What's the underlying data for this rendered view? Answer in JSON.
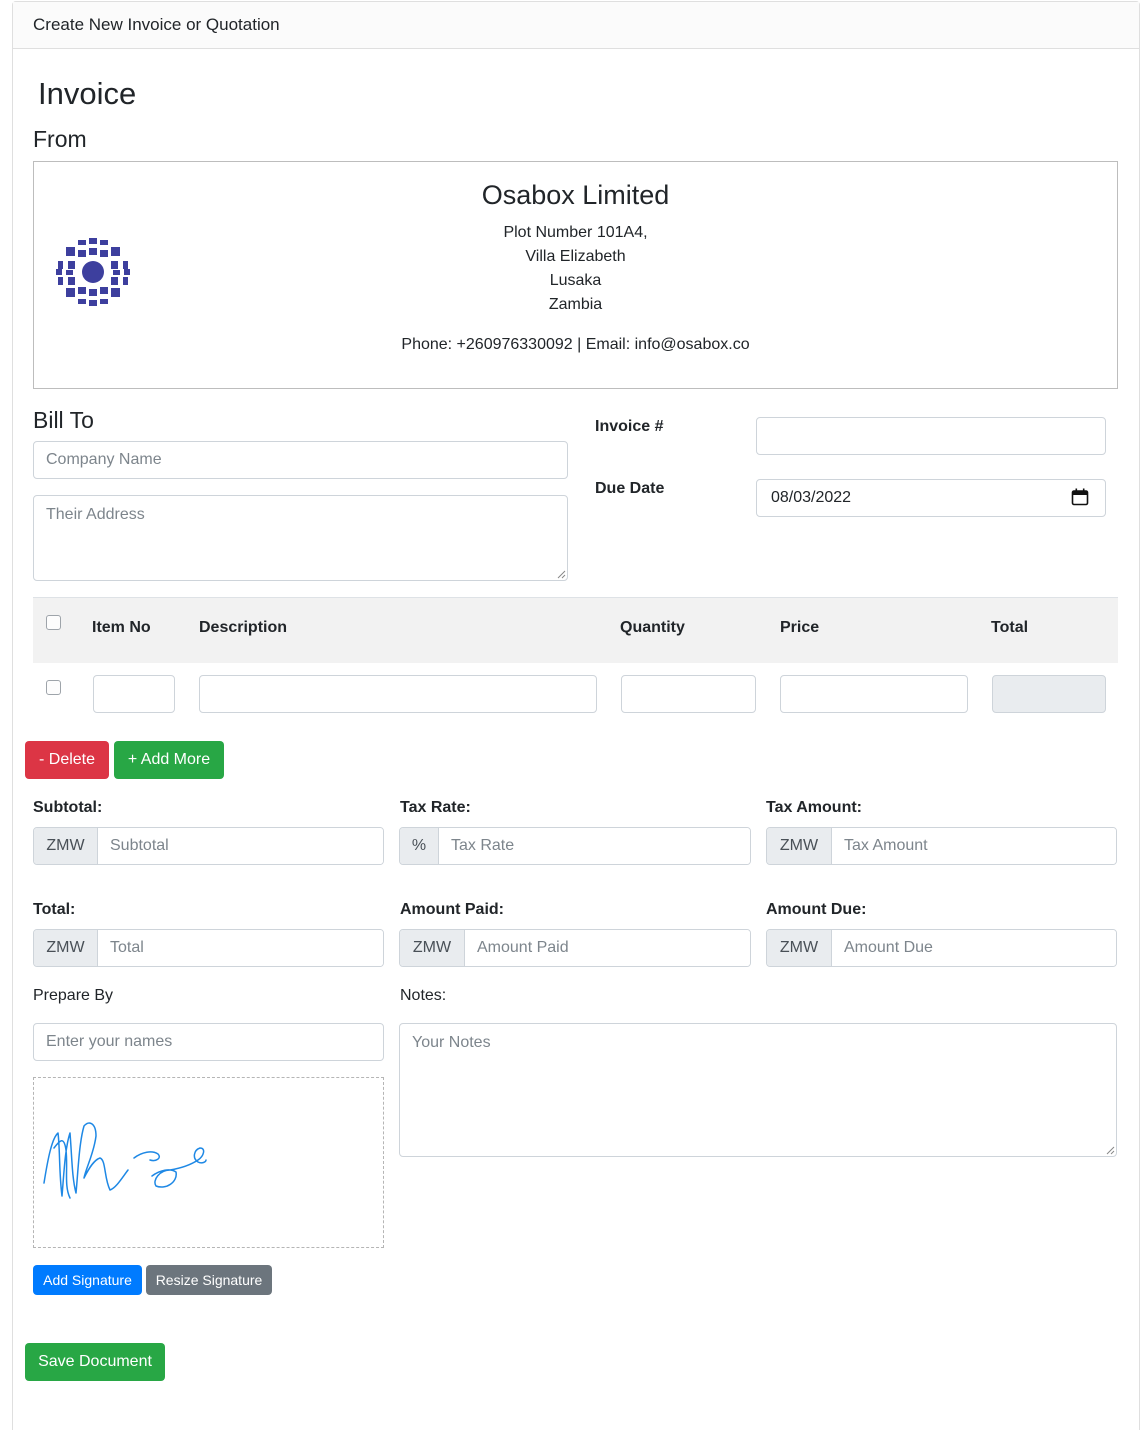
{
  "header": {
    "title": "Create New Invoice or Quotation"
  },
  "page": {
    "heading": "Invoice",
    "from_label": "From"
  },
  "company": {
    "name": "Osabox Limited",
    "address_line1": "Plot Number 101A4,",
    "address_line2": "Villa Elizabeth",
    "address_line3": "Lusaka",
    "address_line4": "Zambia",
    "contact": "Phone: +260976330092 | Email: info@osabox.co",
    "logo_icon": "company-logo-icon",
    "logo_color": "#3d3f9e"
  },
  "bill_to": {
    "label": "Bill To",
    "company_placeholder": "Company Name",
    "address_placeholder": "Their Address"
  },
  "invoice_meta": {
    "invoice_no_label": "Invoice #",
    "invoice_no_value": "",
    "due_date_label": "Due Date",
    "due_date_value": "08/03/2022"
  },
  "items_table": {
    "columns": [
      "Item No",
      "Description",
      "Quantity",
      "Price",
      "Total"
    ]
  },
  "actions": {
    "delete_label": "- Delete",
    "add_more_label": "+ Add More"
  },
  "totals": {
    "subtotal": {
      "label": "Subtotal:",
      "prefix": "ZMW",
      "placeholder": "Subtotal"
    },
    "tax_rate": {
      "label": "Tax Rate:",
      "prefix": "%",
      "placeholder": "Tax Rate"
    },
    "tax_amount": {
      "label": "Tax Amount:",
      "prefix": "ZMW",
      "placeholder": "Tax Amount"
    },
    "total": {
      "label": "Total:",
      "prefix": "ZMW",
      "placeholder": "Total"
    },
    "amount_paid": {
      "label": "Amount Paid:",
      "prefix": "ZMW",
      "placeholder": "Amount Paid"
    },
    "amount_due": {
      "label": "Amount Due:",
      "prefix": "ZMW",
      "placeholder": "Amount Due"
    }
  },
  "prepared": {
    "label": "Prepare By",
    "placeholder": "Enter your names"
  },
  "notes": {
    "label": "Notes:",
    "placeholder": "Your Notes"
  },
  "signature": {
    "add_label": "Add Signature",
    "resize_label": "Resize Signature",
    "stroke_color": "#1e88e5"
  },
  "save": {
    "label": "Save Document"
  },
  "colors": {
    "danger": "#dc3545",
    "success": "#28a745",
    "primary": "#007bff",
    "secondary": "#6c757d"
  }
}
